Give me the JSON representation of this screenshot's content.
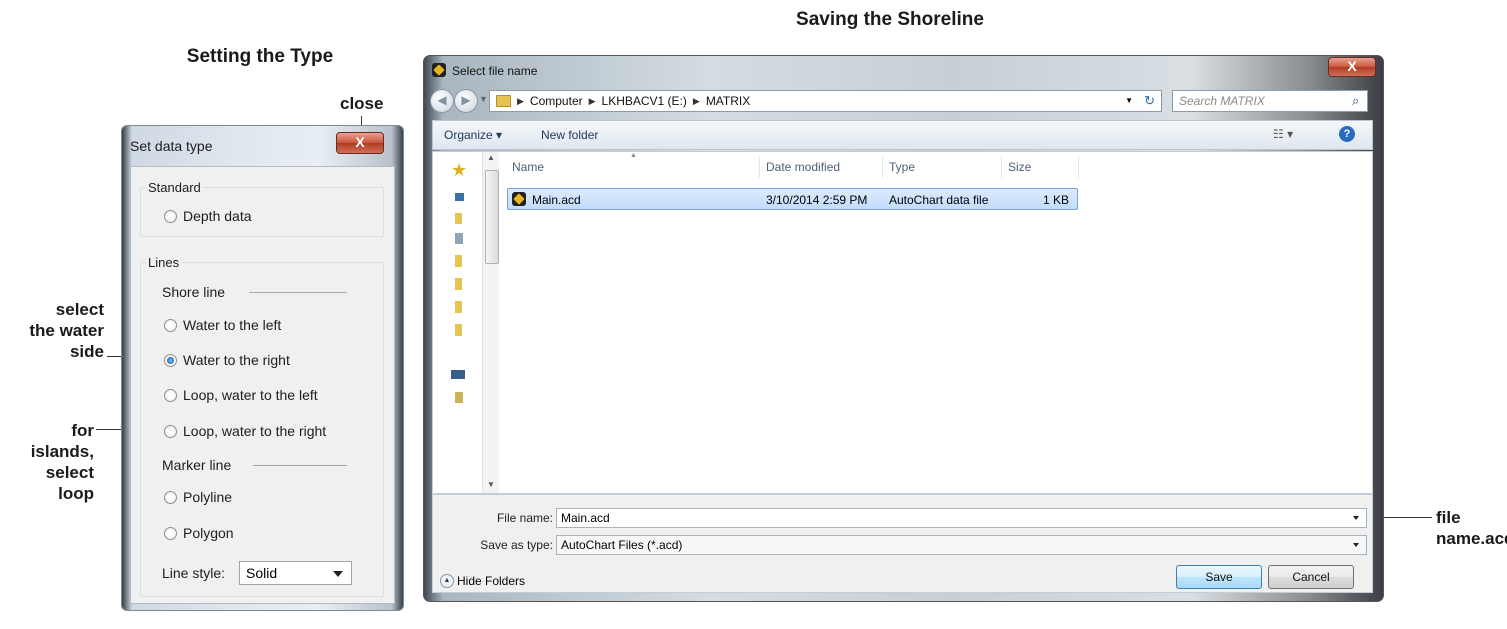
{
  "headings": {
    "left": "Setting the Type",
    "right": "Saving the Shoreline"
  },
  "callouts": {
    "close": "close",
    "water_side": [
      "select",
      "the water",
      "side"
    ],
    "islands": [
      "for",
      "islands,",
      "select",
      "loop"
    ],
    "file_name": [
      "file",
      "name.acd"
    ]
  },
  "set_data_type": {
    "title": "Set data type",
    "close_glyph": "X",
    "standard_group": "Standard",
    "depth_data": "Depth data",
    "lines_group": "Lines",
    "shore_line": "Shore line",
    "options": [
      {
        "label": "Water to the left",
        "checked": false
      },
      {
        "label": "Water to the right",
        "checked": true
      },
      {
        "label": "Loop, water to the left",
        "checked": false
      },
      {
        "label": "Loop, water to the right",
        "checked": false
      }
    ],
    "marker_line": "Marker line",
    "marker_options": [
      "Polyline",
      "Polygon"
    ],
    "line_style_label": "Line style:",
    "line_style_value": "Solid"
  },
  "file_dialog": {
    "title": "Select file name",
    "close_glyph": "X",
    "path": [
      "Computer",
      "LKHBACV1 (E:)",
      "MATRIX"
    ],
    "search_placeholder": "Search MATRIX",
    "organize": "Organize ▾",
    "new_folder": "New folder",
    "columns": [
      "Name",
      "Date modified",
      "Type",
      "Size"
    ],
    "files": [
      {
        "name": "Main.acd",
        "date": "3/10/2014 2:59 PM",
        "type": "AutoChart data file",
        "size": "1 KB"
      }
    ],
    "file_name_label": "File name:",
    "file_name_value": "Main.acd",
    "save_type_label": "Save as type:",
    "save_type_value": "AutoChart Files (*.acd)",
    "hide_folders": "Hide Folders",
    "save": "Save",
    "cancel": "Cancel"
  },
  "colors": {
    "close_red": "#c9553e",
    "selection_blue": "#c1dcfc"
  }
}
